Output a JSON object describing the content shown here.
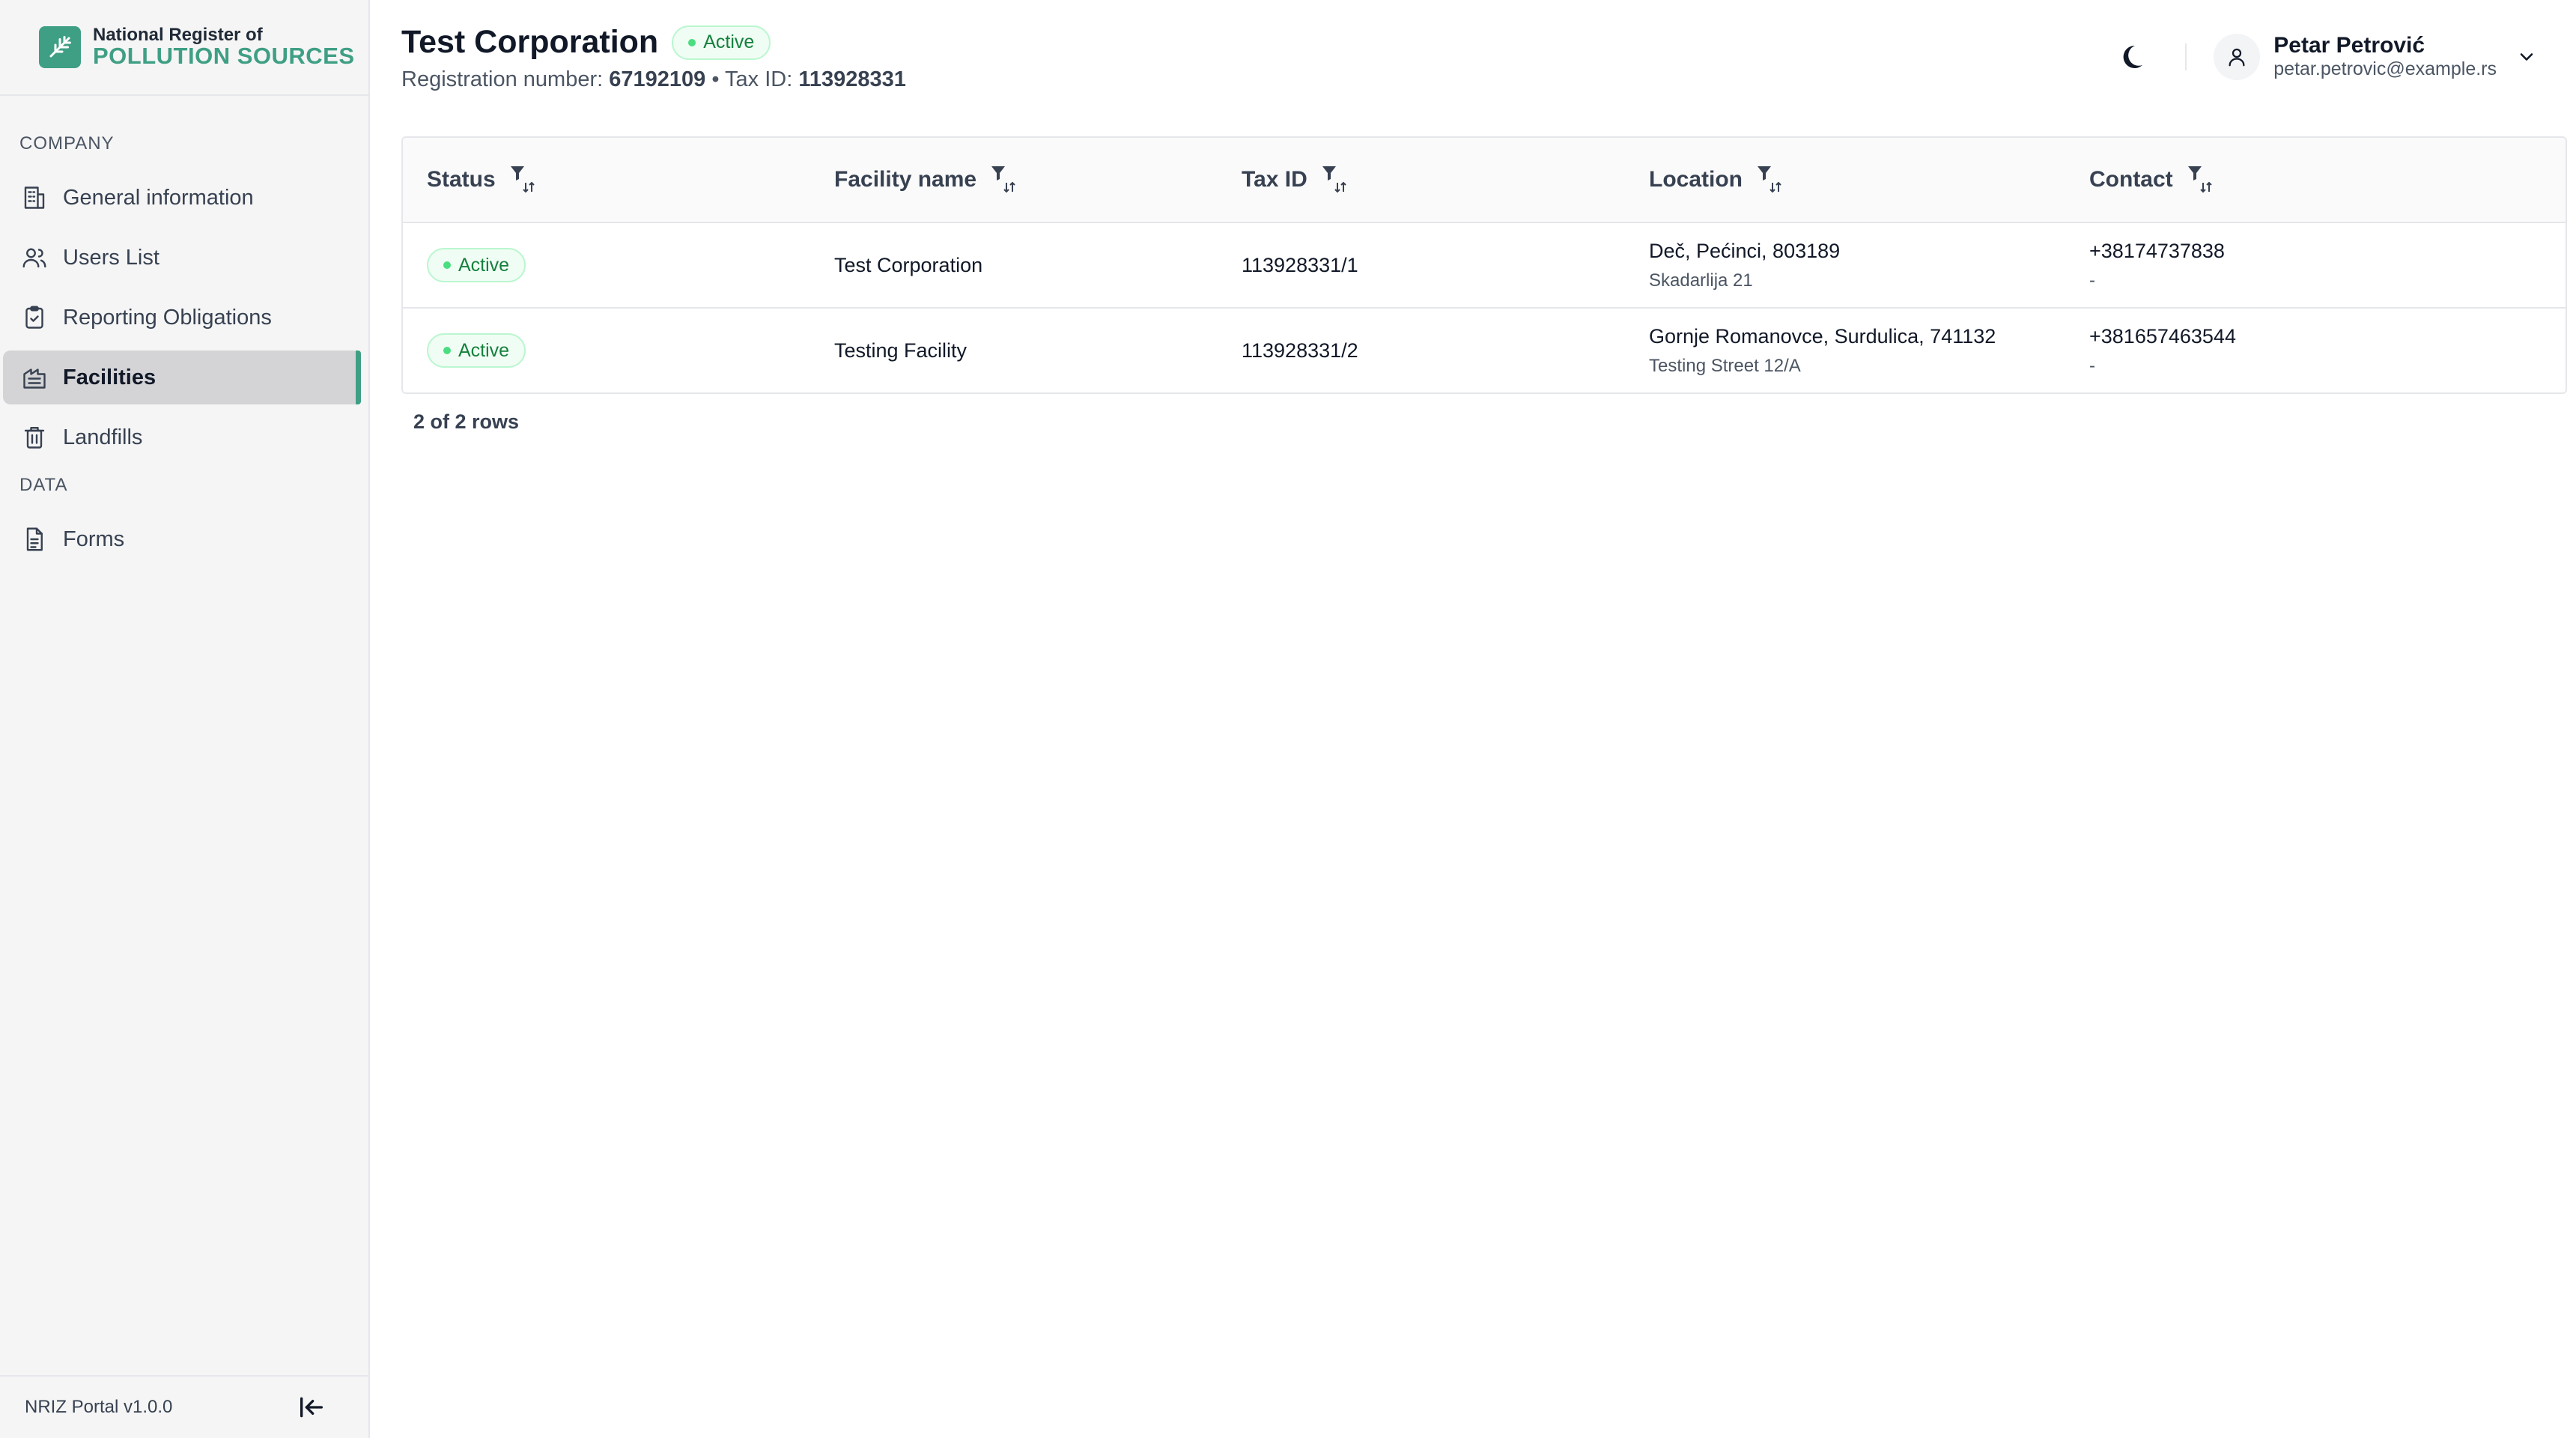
{
  "brand": {
    "line1": "National Register of",
    "line2": "POLLUTION SOURCES",
    "accent_color": "#3f9f84"
  },
  "sidebar": {
    "sections": [
      {
        "label": "COMPANY",
        "items": [
          {
            "label": "General information",
            "icon": "building-icon"
          },
          {
            "label": "Users List",
            "icon": "users-icon"
          },
          {
            "label": "Reporting Obligations",
            "icon": "clipboard-check-icon"
          },
          {
            "label": "Facilities",
            "icon": "factory-icon",
            "active": true
          },
          {
            "label": "Landfills",
            "icon": "trash-icon"
          }
        ]
      },
      {
        "label": "DATA",
        "items": [
          {
            "label": "Forms",
            "icon": "document-icon"
          }
        ]
      }
    ],
    "version": "NRIZ Portal v1.0.0"
  },
  "header": {
    "title": "Test Corporation",
    "status": "Active",
    "reg_label": "Registration number:",
    "reg_value": "67192109",
    "separator": "•",
    "tax_label": "Tax ID:",
    "tax_value": "113928331"
  },
  "user": {
    "name": "Petar Petrović",
    "email": "petar.petrovic@example.rs"
  },
  "table": {
    "columns": [
      "Status",
      "Facility name",
      "Tax ID",
      "Location",
      "Contact"
    ],
    "rows": [
      {
        "status": "Active",
        "name": "Test Corporation",
        "tax_id": "113928331/1",
        "location_line1": "Deč, Pećinci, 803189",
        "location_line2": "Skadarlija 21",
        "contact_line1": "+38174737838",
        "contact_line2": "-"
      },
      {
        "status": "Active",
        "name": "Testing Facility",
        "tax_id": "113928331/2",
        "location_line1": "Gornje Romanovce, Surdulica, 741132",
        "location_line2": "Testing Street 12/A",
        "contact_line1": "+381657463544",
        "contact_line2": "-"
      }
    ],
    "row_count_text": "2 of 2 rows"
  },
  "colors": {
    "active_bg": "#f0fdf4",
    "active_border": "#bbf7d0",
    "active_text": "#15803d",
    "sidebar_active_bg": "#d4d4d6"
  }
}
